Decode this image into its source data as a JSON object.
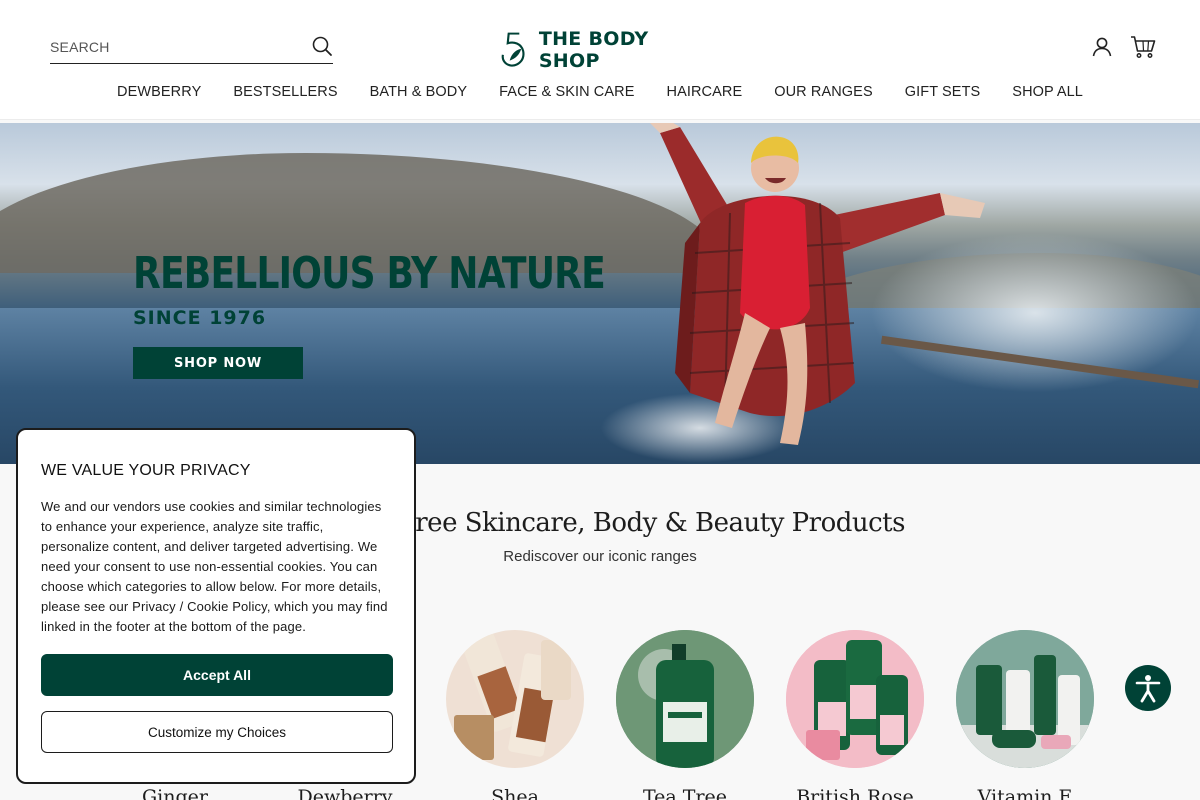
{
  "search": {
    "placeholder": "SEARCH"
  },
  "brand": {
    "logo_text": "THE BODY SHOP"
  },
  "nav": [
    {
      "label": "DEWBERRY"
    },
    {
      "label": "BESTSELLERS"
    },
    {
      "label": "BATH & BODY"
    },
    {
      "label": "FACE & SKIN CARE"
    },
    {
      "label": "HAIRCARE"
    },
    {
      "label": "OUR RANGES"
    },
    {
      "label": "GIFT SETS"
    },
    {
      "label": "SHOP ALL"
    }
  ],
  "hero": {
    "title": "REBELLIOUS BY NATURE",
    "subtitle": "SINCE 1976",
    "cta": "SHOP NOW"
  },
  "section": {
    "title": "Cruelty-Free Skincare, Body & Beauty Products",
    "subtitle": "Rediscover our iconic ranges"
  },
  "ranges": [
    {
      "name": "Ginger"
    },
    {
      "name": "Dewberry"
    },
    {
      "name": "Shea"
    },
    {
      "name": "Tea Tree"
    },
    {
      "name": "British Rose"
    },
    {
      "name": "Vitamin E"
    }
  ],
  "privacy": {
    "title": "WE VALUE YOUR PRIVACY",
    "body": "We and our vendors use cookies and similar technologies to enhance your experience, analyze site traffic, personalize content, and deliver targeted advertising. We need your consent to use non-essential cookies. You can choose which categories to allow below. For more details, please see our Privacy / Cookie Policy, which you may find linked in the footer at the bottom of the page.",
    "accept": "Accept All",
    "customize": "Customize my Choices"
  },
  "colors": {
    "brand_green": "#004236",
    "background": "#f8f8f8"
  },
  "icons": [
    "search-icon",
    "logo-leaf-icon",
    "account-icon",
    "cart-icon",
    "accessibility-icon"
  ]
}
